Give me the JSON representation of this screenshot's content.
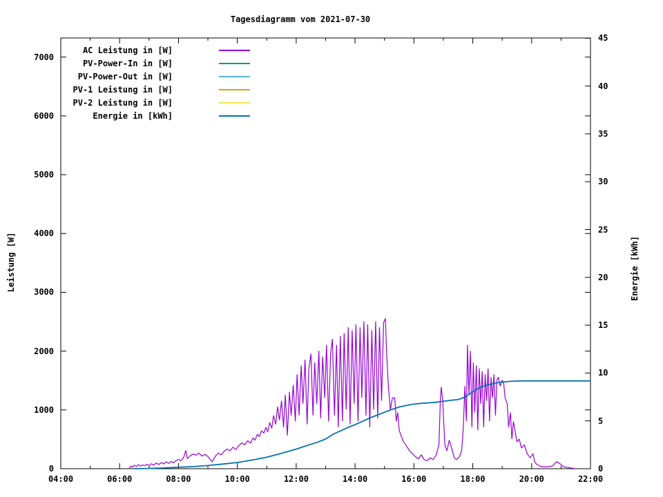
{
  "title": "Tagesdiagramm vom 2021-07-30",
  "axes": {
    "left": {
      "label": "Leistung [W]",
      "ticks": [
        "0",
        "1000",
        "2000",
        "3000",
        "4000",
        "5000",
        "6000",
        "7000"
      ]
    },
    "right": {
      "label": "Energie [kWh]",
      "ticks": [
        "0",
        "5",
        "10",
        "15",
        "20",
        "25",
        "30",
        "35",
        "40",
        "45"
      ]
    },
    "x": {
      "ticks": [
        "04:00",
        "06:00",
        "08:00",
        "10:00",
        "12:00",
        "14:00",
        "16:00",
        "18:00",
        "20:00",
        "22:00"
      ]
    }
  },
  "legend": [
    {
      "label": "AC Leistung in [W]",
      "color": "#9400d3"
    },
    {
      "label": "PV-Power-In in [W]",
      "color": "#009e73"
    },
    {
      "label": "PV-Power-Out in [W]",
      "color": "#56b4e9"
    },
    {
      "label": "PV-1 Leistung in [W]",
      "color": "#e69f00"
    },
    {
      "label": "PV-2 Leistung in [W]",
      "color": "#f0e442"
    },
    {
      "label": "Energie in [kWh]",
      "color": "#0072b2"
    }
  ],
  "chart_data": {
    "type": "line",
    "title": "Tagesdiagramm vom 2021-07-30",
    "ylabel": "Leistung [W]",
    "y2label": "Energie [kWh]",
    "x_unit": "hour_of_day",
    "xlim": [
      4,
      22
    ],
    "ylim": [
      0,
      7330
    ],
    "y2lim": [
      0,
      45
    ],
    "x_tick_hours": [
      4,
      6,
      8,
      10,
      12,
      14,
      16,
      18,
      20,
      22
    ],
    "x_minor_hours": [
      5,
      7,
      9,
      11,
      13,
      15,
      17,
      19,
      21
    ],
    "y_tick_values": [
      0,
      1000,
      2000,
      3000,
      4000,
      5000,
      6000,
      7000
    ],
    "y2_tick_values": [
      0,
      5,
      10,
      15,
      20,
      25,
      30,
      35,
      40,
      45
    ],
    "grid": false,
    "legend_position": "top-left-inside",
    "series": [
      {
        "name": "AC Leistung in [W]",
        "color": "#9400d3",
        "axis": "y1",
        "width": 1.2,
        "points": [
          [
            6.33,
            10
          ],
          [
            6.38,
            45
          ],
          [
            6.43,
            25
          ],
          [
            6.5,
            60
          ],
          [
            6.57,
            35
          ],
          [
            6.63,
            70
          ],
          [
            6.7,
            45
          ],
          [
            6.78,
            65
          ],
          [
            6.85,
            50
          ],
          [
            6.93,
            75
          ],
          [
            7.0,
            55
          ],
          [
            7.08,
            85
          ],
          [
            7.15,
            60
          ],
          [
            7.25,
            95
          ],
          [
            7.33,
            70
          ],
          [
            7.42,
            105
          ],
          [
            7.5,
            80
          ],
          [
            7.58,
            115
          ],
          [
            7.67,
            90
          ],
          [
            7.75,
            125
          ],
          [
            7.83,
            100
          ],
          [
            7.92,
            140
          ],
          [
            8.0,
            160
          ],
          [
            8.08,
            135
          ],
          [
            8.17,
            185
          ],
          [
            8.25,
            310
          ],
          [
            8.3,
            170
          ],
          [
            8.4,
            220
          ],
          [
            8.5,
            250
          ],
          [
            8.6,
            230
          ],
          [
            8.7,
            265
          ],
          [
            8.8,
            215
          ],
          [
            8.9,
            245
          ],
          [
            9.0,
            205
          ],
          [
            9.08,
            155
          ],
          [
            9.15,
            120
          ],
          [
            9.25,
            210
          ],
          [
            9.35,
            265
          ],
          [
            9.45,
            235
          ],
          [
            9.55,
            295
          ],
          [
            9.65,
            335
          ],
          [
            9.75,
            305
          ],
          [
            9.85,
            365
          ],
          [
            9.95,
            325
          ],
          [
            10.05,
            395
          ],
          [
            10.15,
            440
          ],
          [
            10.25,
            405
          ],
          [
            10.35,
            475
          ],
          [
            10.45,
            435
          ],
          [
            10.53,
            525
          ],
          [
            10.6,
            485
          ],
          [
            10.68,
            585
          ],
          [
            10.75,
            545
          ],
          [
            10.82,
            645
          ],
          [
            10.9,
            605
          ],
          [
            10.97,
            705
          ],
          [
            11.03,
            625
          ],
          [
            11.1,
            785
          ],
          [
            11.17,
            685
          ],
          [
            11.23,
            905
          ],
          [
            11.3,
            755
          ],
          [
            11.37,
            1055
          ],
          [
            11.43,
            825
          ],
          [
            11.5,
            1155
          ],
          [
            11.57,
            705
          ],
          [
            11.63,
            1255
          ],
          [
            11.7,
            565
          ],
          [
            11.77,
            1305
          ],
          [
            11.83,
            905
          ],
          [
            11.9,
            1425
          ],
          [
            11.97,
            805
          ],
          [
            12.03,
            1605
          ],
          [
            12.1,
            905
          ],
          [
            12.17,
            1755
          ],
          [
            12.23,
            1105
          ],
          [
            12.3,
            1855
          ],
          [
            12.37,
            755
          ],
          [
            12.43,
            1705
          ],
          [
            12.5,
            1955
          ],
          [
            12.57,
            905
          ],
          [
            12.63,
            1805
          ],
          [
            12.7,
            1105
          ],
          [
            12.77,
            2005
          ],
          [
            12.83,
            855
          ],
          [
            12.9,
            1905
          ],
          [
            12.97,
            1205
          ],
          [
            13.03,
            2105
          ],
          [
            13.1,
            805
          ],
          [
            13.17,
            1955
          ],
          [
            13.23,
            2205
          ],
          [
            13.3,
            905
          ],
          [
            13.37,
            2105
          ],
          [
            13.43,
            705
          ],
          [
            13.5,
            2255
          ],
          [
            13.57,
            805
          ],
          [
            13.63,
            2305
          ],
          [
            13.7,
            1005
          ],
          [
            13.77,
            2405
          ],
          [
            13.83,
            755
          ],
          [
            13.9,
            2355
          ],
          [
            13.97,
            1105
          ],
          [
            14.03,
            2455
          ],
          [
            14.1,
            805
          ],
          [
            14.17,
            2405
          ],
          [
            14.23,
            1205
          ],
          [
            14.3,
            2505
          ],
          [
            14.37,
            905
          ],
          [
            14.43,
            2455
          ],
          [
            14.5,
            705
          ],
          [
            14.57,
            2355
          ],
          [
            14.63,
            1005
          ],
          [
            14.7,
            2505
          ],
          [
            14.77,
            855
          ],
          [
            14.83,
            2405
          ],
          [
            14.9,
            1155
          ],
          [
            14.97,
            2485
          ],
          [
            15.03,
            2555
          ],
          [
            15.08,
            1905
          ],
          [
            15.13,
            1405
          ],
          [
            15.2,
            1005
          ],
          [
            15.27,
            1205
          ],
          [
            15.35,
            1205
          ],
          [
            15.4,
            805
          ],
          [
            15.45,
            955
          ],
          [
            15.5,
            655
          ],
          [
            15.57,
            555
          ],
          [
            15.65,
            455
          ],
          [
            15.75,
            385
          ],
          [
            15.85,
            305
          ],
          [
            15.95,
            255
          ],
          [
            16.05,
            205
          ],
          [
            16.15,
            165
          ],
          [
            16.25,
            235
          ],
          [
            16.35,
            155
          ],
          [
            16.45,
            135
          ],
          [
            16.55,
            185
          ],
          [
            16.65,
            155
          ],
          [
            16.75,
            225
          ],
          [
            16.85,
            405
          ],
          [
            16.9,
            1205
          ],
          [
            16.93,
            1390
          ],
          [
            16.98,
            1150
          ],
          [
            17.05,
            405
          ],
          [
            17.12,
            305
          ],
          [
            17.2,
            485
          ],
          [
            17.28,
            355
          ],
          [
            17.37,
            185
          ],
          [
            17.45,
            155
          ],
          [
            17.55,
            205
          ],
          [
            17.62,
            305
          ],
          [
            17.68,
            705
          ],
          [
            17.73,
            1405
          ],
          [
            17.78,
            805
          ],
          [
            17.82,
            2105
          ],
          [
            17.87,
            1255
          ],
          [
            17.92,
            2005
          ],
          [
            17.97,
            705
          ],
          [
            18.02,
            1805
          ],
          [
            18.07,
            955
          ],
          [
            18.12,
            1755
          ],
          [
            18.17,
            655
          ],
          [
            18.22,
            1705
          ],
          [
            18.27,
            1105
          ],
          [
            18.32,
            1655
          ],
          [
            18.37,
            705
          ],
          [
            18.42,
            1605
          ],
          [
            18.47,
            1155
          ],
          [
            18.52,
            1705
          ],
          [
            18.57,
            805
          ],
          [
            18.62,
            1555
          ],
          [
            18.67,
            1205
          ],
          [
            18.72,
            1605
          ],
          [
            18.77,
            905
          ],
          [
            18.82,
            1505
          ],
          [
            18.87,
            1555
          ],
          [
            18.93,
            1405
          ],
          [
            19.0,
            1505
          ],
          [
            19.05,
            1455
          ],
          [
            19.1,
            1205
          ],
          [
            19.17,
            1105
          ],
          [
            19.22,
            705
          ],
          [
            19.28,
            955
          ],
          [
            19.33,
            505
          ],
          [
            19.38,
            805
          ],
          [
            19.45,
            605
          ],
          [
            19.5,
            455
          ],
          [
            19.58,
            505
          ],
          [
            19.65,
            355
          ],
          [
            19.75,
            405
          ],
          [
            19.85,
            255
          ],
          [
            19.95,
            185
          ],
          [
            20.05,
            255
          ],
          [
            20.1,
            120
          ],
          [
            20.18,
            70
          ],
          [
            20.3,
            40
          ],
          [
            20.45,
            30
          ],
          [
            20.6,
            35
          ],
          [
            20.72,
            50
          ],
          [
            20.85,
            120
          ],
          [
            20.95,
            90
          ],
          [
            21.05,
            45
          ],
          [
            21.15,
            25
          ],
          [
            21.25,
            20
          ],
          [
            21.35,
            10
          ],
          [
            21.45,
            5
          ]
        ]
      },
      {
        "name": "PV-Power-In in [W]",
        "color": "#009e73",
        "axis": "y1",
        "width": 1.2,
        "points": []
      },
      {
        "name": "PV-Power-Out in [W]",
        "color": "#56b4e9",
        "axis": "y1",
        "width": 1.2,
        "points": []
      },
      {
        "name": "PV-1 Leistung in [W]",
        "color": "#e69f00",
        "axis": "y1",
        "width": 1.2,
        "points": []
      },
      {
        "name": "PV-2 Leistung in [W]",
        "color": "#f0e442",
        "axis": "y1",
        "width": 1.2,
        "points": []
      },
      {
        "name": "Energie in [kWh]",
        "color": "#0072b2",
        "axis": "y2",
        "width": 1.8,
        "points": [
          [
            6.5,
            0.0
          ],
          [
            7.0,
            0.03
          ],
          [
            7.5,
            0.08
          ],
          [
            8.0,
            0.15
          ],
          [
            8.5,
            0.22
          ],
          [
            9.0,
            0.33
          ],
          [
            9.5,
            0.48
          ],
          [
            10.0,
            0.65
          ],
          [
            10.5,
            0.9
          ],
          [
            11.0,
            1.2
          ],
          [
            11.5,
            1.6
          ],
          [
            12.0,
            2.05
          ],
          [
            12.25,
            2.3
          ],
          [
            12.5,
            2.55
          ],
          [
            12.75,
            2.8
          ],
          [
            13.0,
            3.1
          ],
          [
            13.25,
            3.6
          ],
          [
            13.5,
            3.95
          ],
          [
            13.75,
            4.3
          ],
          [
            14.0,
            4.6
          ],
          [
            14.25,
            4.95
          ],
          [
            14.5,
            5.3
          ],
          [
            14.75,
            5.6
          ],
          [
            15.0,
            5.9
          ],
          [
            15.25,
            6.2
          ],
          [
            15.5,
            6.45
          ],
          [
            15.75,
            6.62
          ],
          [
            16.0,
            6.75
          ],
          [
            16.25,
            6.83
          ],
          [
            16.5,
            6.88
          ],
          [
            16.75,
            6.94
          ],
          [
            17.0,
            7.05
          ],
          [
            17.25,
            7.15
          ],
          [
            17.5,
            7.22
          ],
          [
            17.75,
            7.5
          ],
          [
            18.0,
            8.05
          ],
          [
            18.25,
            8.5
          ],
          [
            18.5,
            8.75
          ],
          [
            18.75,
            8.95
          ],
          [
            19.0,
            9.05
          ],
          [
            19.25,
            9.13
          ],
          [
            19.5,
            9.16
          ],
          [
            19.75,
            9.18
          ],
          [
            20.5,
            9.18
          ],
          [
            21.0,
            9.18
          ],
          [
            22.0,
            9.18
          ]
        ]
      }
    ]
  }
}
